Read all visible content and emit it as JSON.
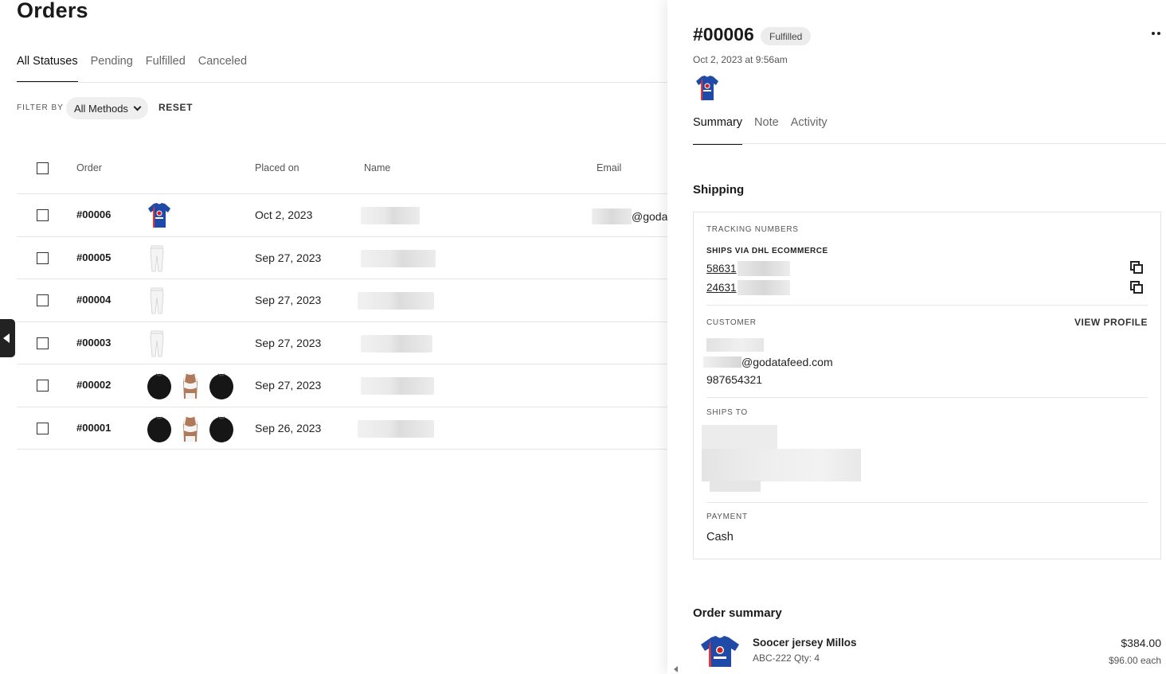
{
  "page": {
    "title": "Orders"
  },
  "status_tabs": [
    "All Statuses",
    "Pending",
    "Fulfilled",
    "Canceled"
  ],
  "filter": {
    "label": "FILTER BY",
    "method": "All Methods",
    "reset": "RESET"
  },
  "table": {
    "columns": {
      "order": "Order",
      "placed_on": "Placed on",
      "name": "Name",
      "email": "Email"
    },
    "rows": [
      {
        "order": "#00006",
        "placed_on": "Oct 2, 2023",
        "email_suffix": "@goda",
        "products": [
          "jersey"
        ]
      },
      {
        "order": "#00005",
        "placed_on": "Sep 27, 2023",
        "email_suffix": "",
        "products": [
          "pants"
        ]
      },
      {
        "order": "#00004",
        "placed_on": "Sep 27, 2023",
        "email_suffix": "",
        "products": [
          "pants"
        ]
      },
      {
        "order": "#00003",
        "placed_on": "Sep 27, 2023",
        "email_suffix": "",
        "products": [
          "pants"
        ]
      },
      {
        "order": "#00002",
        "placed_on": "Sep 27, 2023",
        "email_suffix": "",
        "products": [
          "hoodie",
          "bra",
          "hoodie"
        ]
      },
      {
        "order": "#00001",
        "placed_on": "Sep 26, 2023",
        "email_suffix": "",
        "products": [
          "hoodie",
          "bra",
          "hoodie"
        ]
      }
    ]
  },
  "detail": {
    "order_number": "#00006",
    "status": "Fulfilled",
    "placed_at": "Oct 2, 2023 at 9:56am",
    "tabs": [
      "Summary",
      "Note",
      "Activity"
    ],
    "shipping": {
      "heading": "Shipping",
      "tracking_label": "TRACKING NUMBERS",
      "carrier_label": "SHIPS VIA DHL ECOMMERCE",
      "tracking_numbers": [
        "58631",
        "24631"
      ],
      "customer_label": "CUSTOMER",
      "view_profile": "VIEW PROFILE",
      "customer_email_domain": "@godatafeed.com",
      "customer_phone": "987654321",
      "ships_to_label": "SHIPS TO",
      "payment_label": "PAYMENT",
      "payment_method": "Cash"
    },
    "summary": {
      "heading": "Order summary",
      "item_name": "Soocer jersey Millos",
      "item_meta": "ABC-222 Qty: 4",
      "item_total": "$384.00",
      "item_each": "$96.00 each"
    }
  },
  "colors": {
    "jersey_blue": "#1f4aa8",
    "hoodie_black": "#161616",
    "skin": "#b07a5a"
  },
  "icons": [
    "more-horizontal-icon",
    "copy-icon",
    "chevron-down-icon",
    "collapse-left-icon",
    "mouse-cursor-icon"
  ]
}
